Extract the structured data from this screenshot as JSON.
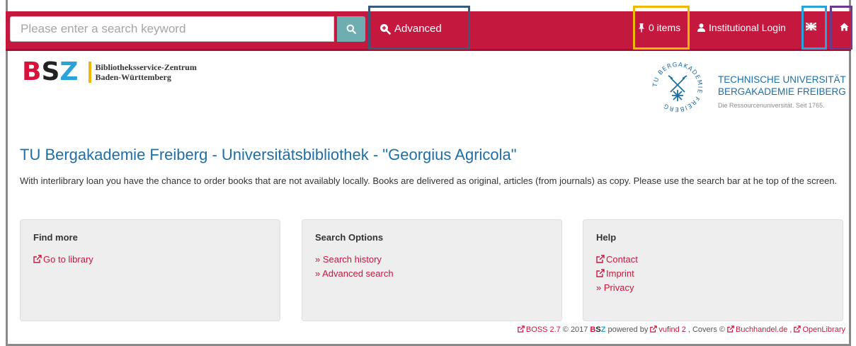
{
  "navbar": {
    "search_placeholder": "Please enter a search keyword",
    "advanced_label": "Advanced",
    "items_label": "0 items",
    "login_label": "Institutional Login",
    "colors": {
      "bar": "#c5183f",
      "search_button": "#6eaeb3"
    }
  },
  "highlights": {
    "advanced": "#3a5a7a",
    "items": "#f2b705",
    "language": "#2aa3dc",
    "home": "#6b3a8a"
  },
  "logos": {
    "bsz_letters": [
      "B",
      "S",
      "Z"
    ],
    "bsz_line1": "Bibliotheksservice-Zentrum",
    "bsz_line2": "Baden-Württemberg",
    "tu_line1": "TECHNISCHE UNIVERSITÄT",
    "tu_line2": "BERGAKADEMIE FREIBERG",
    "tu_line3": "Die Ressourcenuniversität. Seit 1765.",
    "seal_text": "TU BERGAKADEMIE FREIBERG"
  },
  "main": {
    "title": "TU Bergakademie Freiberg - Universitätsbibliothek - \"Georgius Agricola\"",
    "intro": "With interlibrary loan you have the chance to order books that are not availably locally. Books are delivered as original, articles (from journals) as copy. Please use the search bar at he top of the screen."
  },
  "panels": {
    "find_more": {
      "title": "Find more",
      "links": [
        "Go to library"
      ]
    },
    "search_options": {
      "title": "Search Options",
      "links": [
        "» Search history",
        "» Advanced search"
      ]
    },
    "help": {
      "title": "Help",
      "links": [
        "Contact",
        "Imprint",
        "» Privacy"
      ]
    }
  },
  "footer": {
    "boss": "BOSS 2.7",
    "copyright": "© 2017",
    "powered": "powered by",
    "vufind": "vufind 2",
    "covers": ", Covers ©",
    "buchhandel": "Buchhandel.de",
    "openlibrary": "OpenLibrary"
  }
}
